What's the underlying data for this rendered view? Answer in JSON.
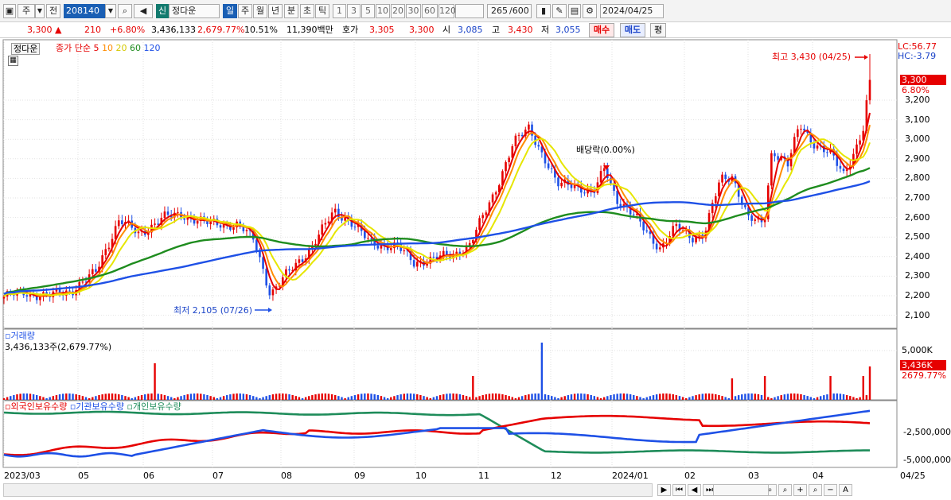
{
  "toolbar": {
    "side_label": "주",
    "prev_label": "전",
    "code": "208140",
    "new_badge": "신",
    "stock_name": "정다운",
    "periods": [
      "일",
      "주",
      "월",
      "년",
      "분",
      "초",
      "틱"
    ],
    "minutes": [
      "1",
      "3",
      "5",
      "10",
      "20",
      "30",
      "60",
      "120"
    ],
    "count": "265",
    "count_total": "/600",
    "date": "2024/04/25"
  },
  "quote": {
    "price": "3,300",
    "change": "210",
    "change_rate": "+6.80%",
    "volume": "3,436,133",
    "volume_rate": "2,679.77%",
    "turnover": "10.51%",
    "amount": "11,390백만",
    "ask_label": "호가",
    "ask": "3,305",
    "bid": "3,300",
    "open_label": "시",
    "open": "3,085",
    "high_label": "고",
    "high": "3,430",
    "low_label": "저",
    "low": "3,055",
    "buy": "매수",
    "sell": "매도",
    "eval": "평"
  },
  "legend": {
    "name": "정다운",
    "type": "종가 단순",
    "ma": [
      "5",
      "10",
      "20",
      "60",
      "120"
    ],
    "colors": [
      "#e60000",
      "#ff8c00",
      "#e6e600",
      "#1e8c1e",
      "#1e50e6"
    ]
  },
  "annotations": {
    "high": "최고 3,430 (04/25)",
    "low": "최저 2,105 (07/26)",
    "dividend": "배당락(0.00%)",
    "lc": "LC:56.77",
    "hc": "HC:-3.79",
    "price_tag": "3,300",
    "pct_tag": "6.80%"
  },
  "price_axis": [
    "3,200",
    "3,100",
    "3,000",
    "2,900",
    "2,800",
    "2,700",
    "2,600",
    "2,500",
    "2,400",
    "2,300",
    "2,200",
    "2,100"
  ],
  "volume_panel": {
    "title": "거래량",
    "value": "3,436,133주(2,679.77%)",
    "axis": "5,000K",
    "tag": "3,436K",
    "tag2": "2679.77%"
  },
  "holdings_panel": {
    "series": [
      "외국인보유수량",
      "기관보유수량",
      "개인보유수량"
    ],
    "colors": [
      "#e60000",
      "#1e50e6",
      "#1e8c5a"
    ],
    "axis": [
      "-2,500,000",
      "-5,000,000"
    ]
  },
  "x_axis": [
    "2023/03",
    "05",
    "06",
    "07",
    "08",
    "09",
    "10",
    "11",
    "12",
    "2024/01",
    "02",
    "03",
    "04"
  ],
  "x_axis_end": "04/25",
  "chart_data": {
    "type": "candlestick",
    "x_range": [
      "2023/03",
      "2024/04/25"
    ],
    "y_range": [
      2105,
      3430
    ],
    "high": {
      "value": 3430,
      "date": "04/25"
    },
    "low": {
      "value": 2105,
      "date": "07/26"
    },
    "last_close": 3300,
    "ma_periods": [
      5,
      10,
      20,
      60,
      120
    ],
    "volume_last": 3436133
  }
}
